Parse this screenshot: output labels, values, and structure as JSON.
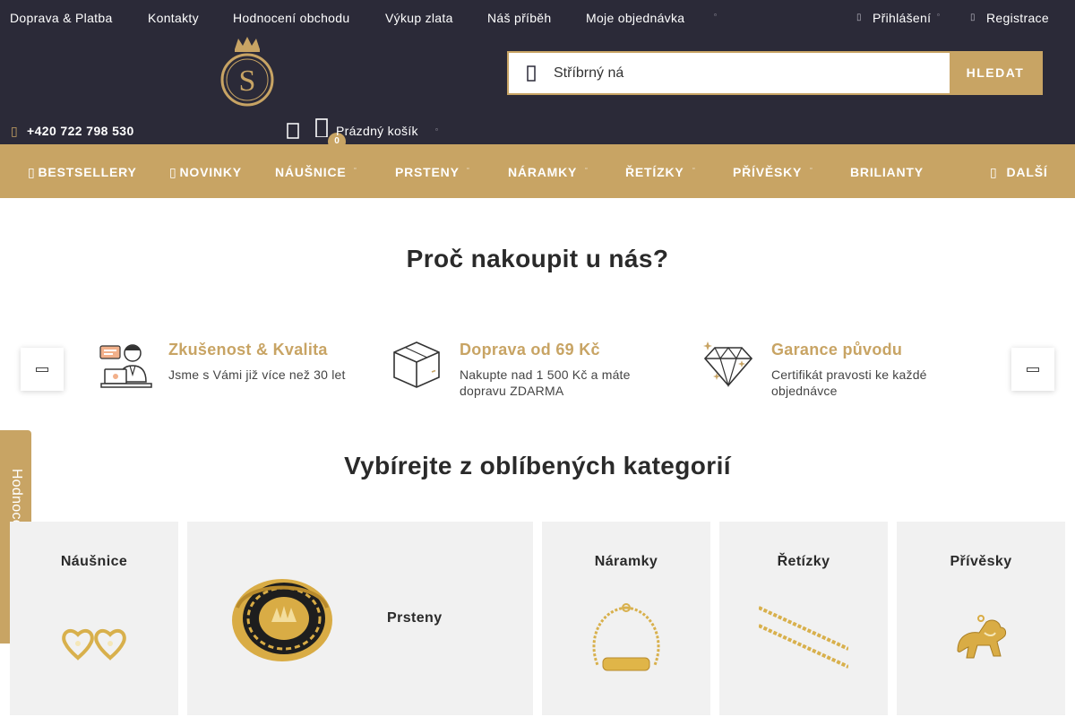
{
  "topbar": {
    "links": [
      "Doprava & Platba",
      "Kontakty",
      "Hodnocení obchodu",
      "Výkup zlata",
      "Náš příběh",
      "Moje objednávka"
    ],
    "login": "Přihlášení",
    "register": "Registrace"
  },
  "header": {
    "search_value": "Stříbrný ná",
    "search_button": "HLEDAT",
    "phone": "+420 722 798 530",
    "cart_count": "0",
    "cart_label": "Prázdný košík"
  },
  "nav": {
    "items": [
      "BESTSELLERY",
      "NOVINKY",
      "NÁUŠNICE",
      "PRSTENY",
      "NÁRAMKY",
      "ŘETÍZKY",
      "PŘÍVĚSKY",
      "BRILIANTY"
    ],
    "more": "DALŠÍ"
  },
  "why": {
    "title": "Proč nakoupit u nás?",
    "features": [
      {
        "title": "Zkušenost & Kvalita",
        "text": "Jsme s Vámi již více než 30 let",
        "icon": "support-person-icon"
      },
      {
        "title": "Doprava od 69 Kč",
        "text": "Nakupte nad 1 500 Kč a máte dopravu ZDARMA",
        "icon": "package-box-icon"
      },
      {
        "title": "Garance původu",
        "text": "Certifikát pravosti ke každé objednávce",
        "icon": "diamond-icon"
      }
    ]
  },
  "categories": {
    "title": "Vybírejte z oblíbených kategorií",
    "items": [
      "Náušnice",
      "Prsteny",
      "Náramky",
      "Řetízky",
      "Přívěsky"
    ]
  },
  "side_tab": "Hodnocení obchodu",
  "colors": {
    "accent": "#c8a464",
    "dark": "#2b2a38"
  }
}
